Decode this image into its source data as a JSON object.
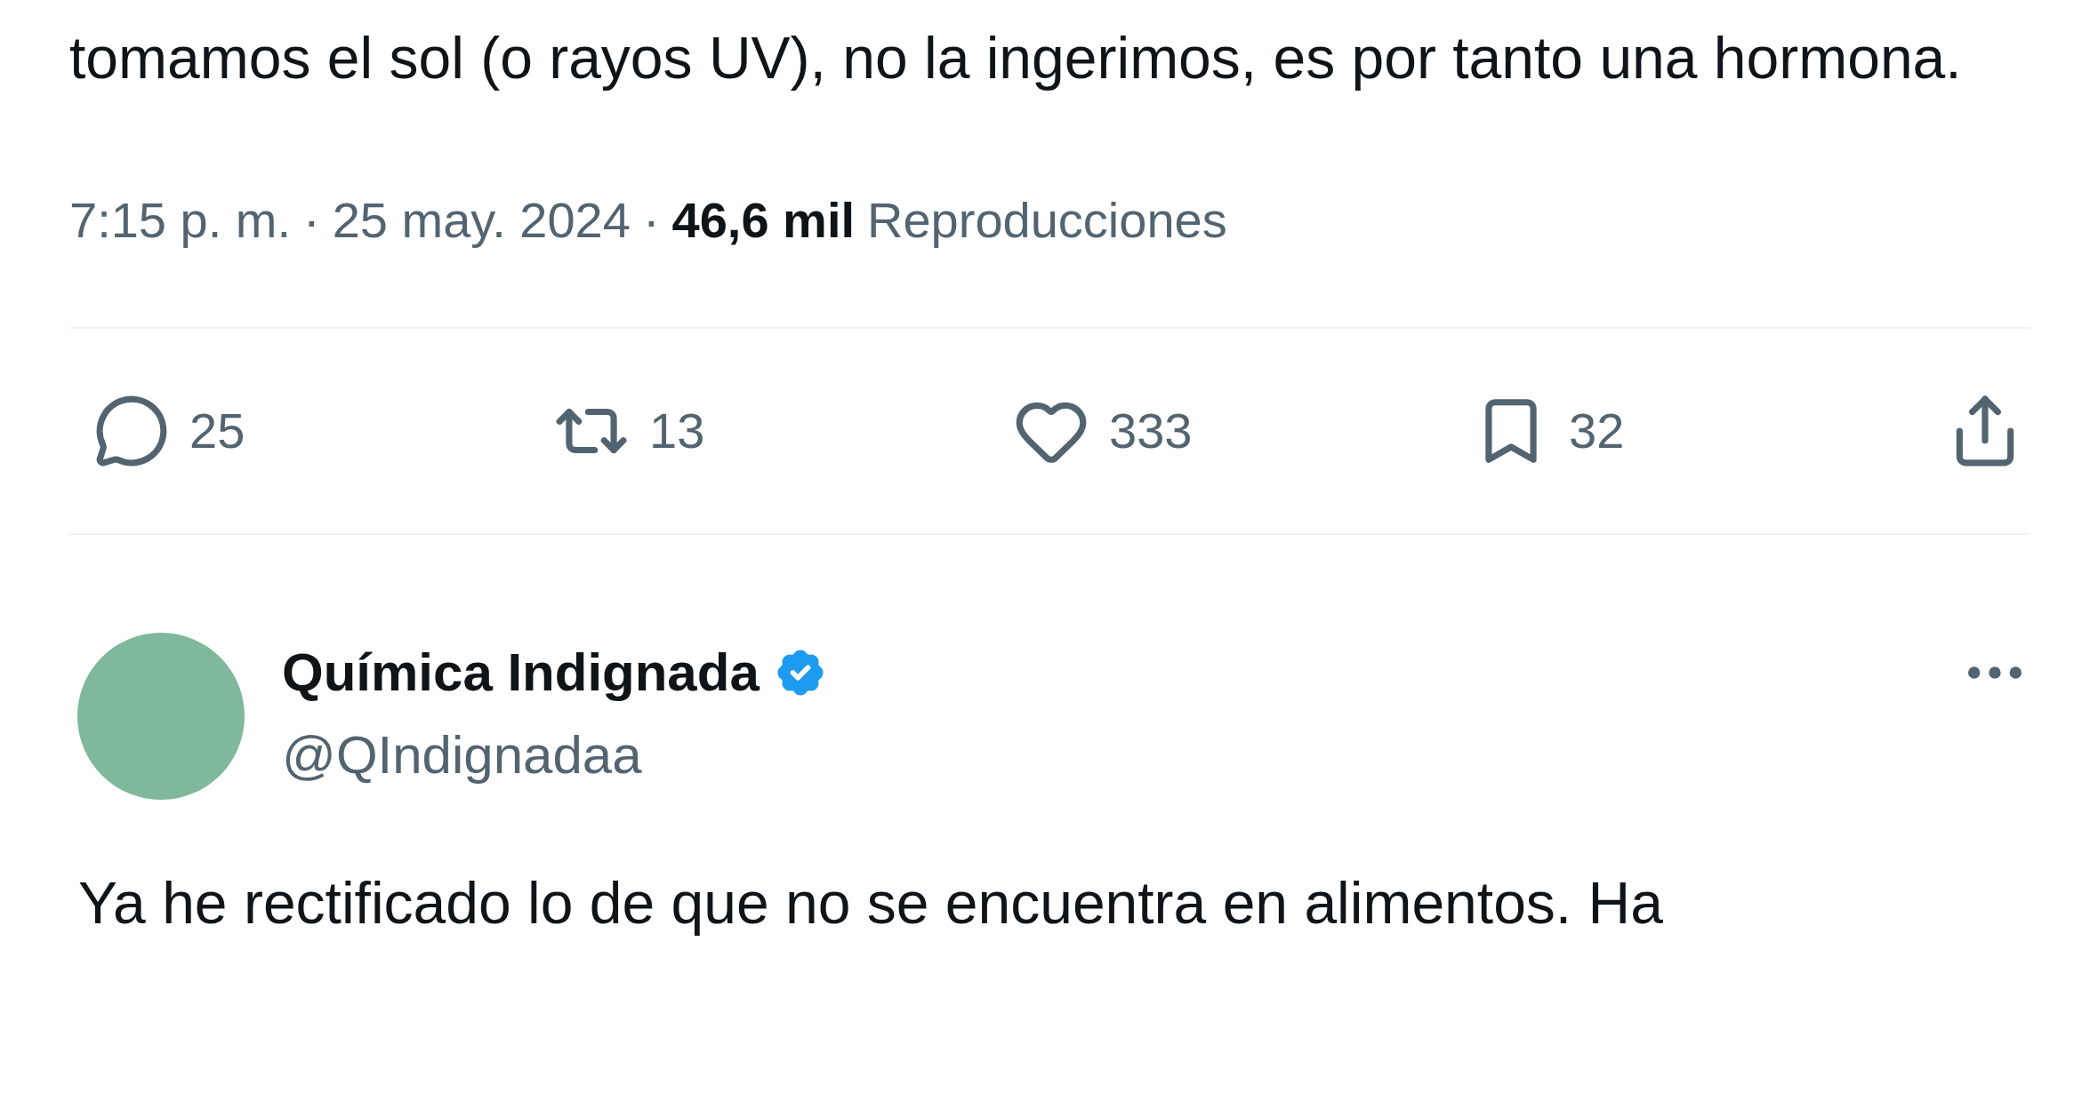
{
  "post": {
    "text": "tomamos el sol (o rayos UV), no la ingerimos, es por tanto una hormona.",
    "meta": {
      "time": "7:15 p. m.",
      "separator": "·",
      "date": "25 may. 2024",
      "views_count": "46,6 mil",
      "views_label": "Reproducciones"
    },
    "actions": [
      {
        "kind": "reply",
        "count": "25"
      },
      {
        "kind": "repost",
        "count": "13"
      },
      {
        "kind": "like",
        "count": "333"
      },
      {
        "kind": "bookmark",
        "count": "32"
      },
      {
        "kind": "share"
      }
    ]
  },
  "reply": {
    "name": "Química Indignada",
    "verified": true,
    "handle": "@QIndignadaa",
    "text": "Ya he rectificado lo de que no se encuentra en alimentos. Ha"
  }
}
